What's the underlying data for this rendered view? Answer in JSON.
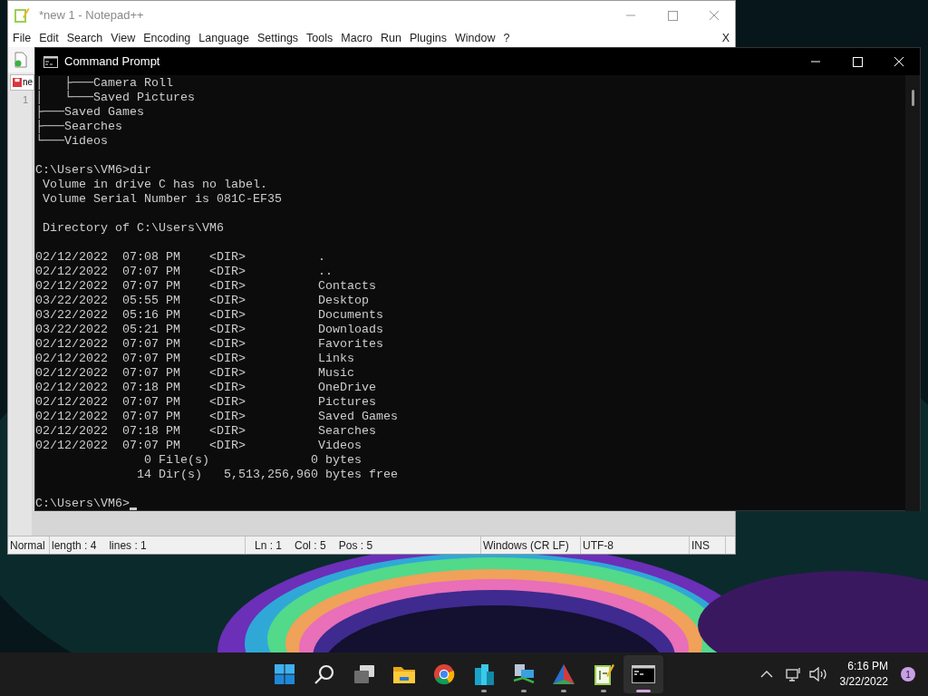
{
  "notepad": {
    "title": "*new 1 - Notepad++",
    "menu": [
      "File",
      "Edit",
      "Search",
      "View",
      "Encoding",
      "Language",
      "Settings",
      "Tools",
      "Macro",
      "Run",
      "Plugins",
      "Window",
      "?"
    ],
    "close_doc": "X",
    "tab_label": "ne",
    "line_number": "1",
    "status": [
      {
        "texts": [
          "Normal"
        ]
      },
      {
        "texts": [
          "length : 4",
          "lines : 1"
        ]
      },
      {
        "texts": [
          "Ln : 1",
          "Col : 5",
          "Pos : 5"
        ]
      },
      {
        "texts": [
          "Windows (CR LF)"
        ]
      },
      {
        "texts": [
          "UTF-8"
        ]
      },
      {
        "texts": [
          "INS"
        ]
      }
    ]
  },
  "console": {
    "title": "Command Prompt",
    "cursor": true,
    "lines": [
      "│   ├───Camera Roll",
      "│   └───Saved Pictures",
      "├───Saved Games",
      "├───Searches",
      "└───Videos",
      {
        "gap_before": true,
        "text": "C:\\Users\\VM6>dir"
      },
      " Volume in drive C has no label.",
      " Volume Serial Number is 081C-EF35",
      {
        "gap_before": true,
        "text": " Directory of C:\\Users\\VM6"
      },
      {
        "gap_before": true,
        "text": "02/12/2022  07:08 PM    <DIR>          ."
      },
      "02/12/2022  07:07 PM    <DIR>          ..",
      "02/12/2022  07:07 PM    <DIR>          Contacts",
      "03/22/2022  05:55 PM    <DIR>          Desktop",
      "03/22/2022  05:16 PM    <DIR>          Documents",
      "03/22/2022  05:21 PM    <DIR>          Downloads",
      "02/12/2022  07:07 PM    <DIR>          Favorites",
      "02/12/2022  07:07 PM    <DIR>          Links",
      "02/12/2022  07:07 PM    <DIR>          Music",
      "02/12/2022  07:18 PM    <DIR>          OneDrive",
      "02/12/2022  07:07 PM    <DIR>          Pictures",
      "02/12/2022  07:07 PM    <DIR>          Saved Games",
      "02/12/2022  07:18 PM    <DIR>          Searches",
      "02/12/2022  07:07 PM    <DIR>          Videos",
      "               0 File(s)              0 bytes",
      "              14 Dir(s)   5,513,256,960 bytes free",
      {
        "gap_before": true,
        "text": "C:\\Users\\VM6>"
      }
    ]
  },
  "taskbar": {
    "apps": [
      {
        "kind": "start",
        "running": false,
        "active": false
      },
      {
        "kind": "search",
        "running": false,
        "active": false
      },
      {
        "kind": "taskview",
        "running": false,
        "active": false
      },
      {
        "kind": "folder",
        "running": false,
        "active": false
      },
      {
        "kind": "browser",
        "running": false,
        "active": false
      },
      {
        "kind": "buildings",
        "running": true,
        "active": false
      },
      {
        "kind": "network",
        "running": true,
        "active": false
      },
      {
        "kind": "triangle",
        "running": true,
        "active": false
      },
      {
        "kind": "notepad",
        "running": true,
        "active": false
      },
      {
        "kind": "terminal",
        "running": true,
        "active": true
      }
    ],
    "time": "6:16 PM",
    "date": "3/22/2022",
    "notifications": "1"
  }
}
